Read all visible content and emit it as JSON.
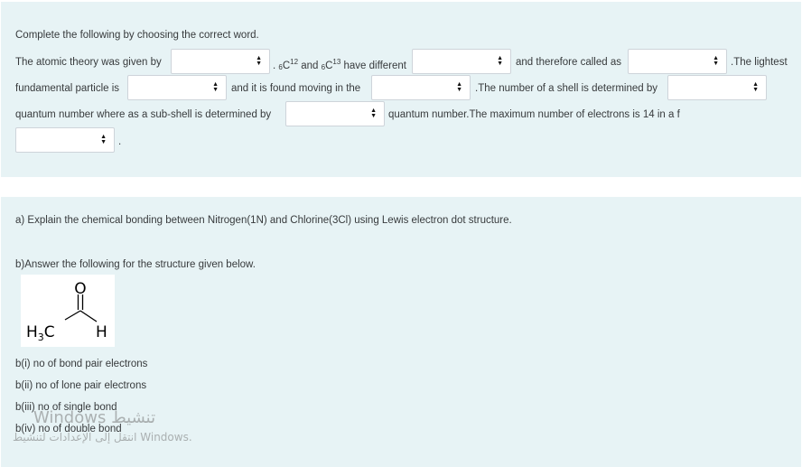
{
  "question1": {
    "instruction": "Complete the following by choosing the correct word.",
    "line1": {
      "a": "The atomic theory was given by",
      "b_prefix": ". ",
      "iso1_sub": "6",
      "iso1_sym": "C",
      "iso1_sup": "12",
      "and": " and ",
      "iso2_sub": "6",
      "iso2_sym": "C",
      "iso2_sup": "13",
      "b_suffix": " have different",
      "c": "and therefore called as",
      "d": ".The lightest"
    },
    "line2": {
      "a": "fundamental particle is",
      "b": "and it is found moving in the",
      "c": ".The number of a shell is determined by"
    },
    "line3": {
      "a": "quantum number where as a sub-shell is determined by",
      "b": "quantum number.The maximum number of electrons is 14 in a f"
    },
    "line4": {
      "end": "."
    }
  },
  "question2": {
    "part_a": "a) Explain the chemical bonding between Nitrogen(1N) and Chlorine(3Cl) using Lewis electron dot structure.",
    "part_b": "b)Answer the following for the structure given below.",
    "structure": {
      "oxygen": "O",
      "methyl": "H",
      "methyl_sub": "3",
      "methyl_c": "C",
      "hydrogen": "H"
    },
    "subparts": [
      "b(i) no of bond pair electrons",
      "b(ii) no of lone pair electrons",
      "b(iii) no of single bond",
      "b(iv) no of double bond"
    ]
  },
  "watermark": {
    "line1": "Windows تنشيط",
    "line2": "انتقل إلى الإعدادات لتنشيط Windows."
  }
}
